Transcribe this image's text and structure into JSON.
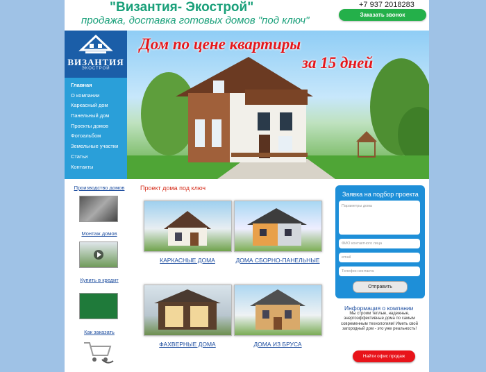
{
  "header": {
    "title": "\"Византия- Экострой\"",
    "slogan": "продажа, доставка готовых домов \"под ключ\"",
    "phone": "+7 937 2018283",
    "callback_label": "Заказать звонок"
  },
  "logo": {
    "word": "ВИЗАНТИЯ",
    "sub": "ЭКОСТРОЙ"
  },
  "nav": {
    "items": [
      {
        "label": "Главная",
        "active": true
      },
      {
        "label": "О компании"
      },
      {
        "label": "Каркасный дом"
      },
      {
        "label": "Панельный дом"
      },
      {
        "label": "Проекты домов"
      },
      {
        "label": "Фотоальбом"
      },
      {
        "label": "Земельные участки"
      },
      {
        "label": "Статьи"
      },
      {
        "label": "Контакты"
      }
    ]
  },
  "banner": {
    "line1": "Дом по цене квартиры",
    "line2": "за 15 дней"
  },
  "left": {
    "links": [
      "Производство домов",
      "Монтаж  домов",
      "Купить в кредит",
      "Как заказать"
    ]
  },
  "projects": {
    "title": "Проект дома под ключ",
    "cards": [
      {
        "label": "КАРКАСНЫЕ ДОМА"
      },
      {
        "label": "ДОМА СБОРНО-ПАНЕЛЬНЫЕ"
      },
      {
        "label": "ФАХВЕРНЫЕ ДОМА"
      },
      {
        "label": "ДОМА ИЗ БРУСА"
      }
    ]
  },
  "form": {
    "title": "Заявка на подбор проекта",
    "params_placeholder": "Параметры дома",
    "name_placeholder": "ФИО контактного лица",
    "email_placeholder": "email",
    "phone_placeholder": "Телефон контакта",
    "submit_label": "Отправить"
  },
  "info": {
    "title": "Информация о компании",
    "text": "Мы строим теплые, надежные, энергоэффективные дома по самым современным технологиям! Иметь свой загородный  дом - это уже реальность!",
    "office_button": "Найти офис продаж"
  },
  "colors": {
    "background": "#9fc2e6",
    "green_title": "#1aa07a",
    "nav_blue": "#2a9fd9",
    "logo_blue": "#1b5ea8",
    "red": "#e5171b",
    "link_blue": "#1f4fa0",
    "callback_green": "#24b04a"
  }
}
